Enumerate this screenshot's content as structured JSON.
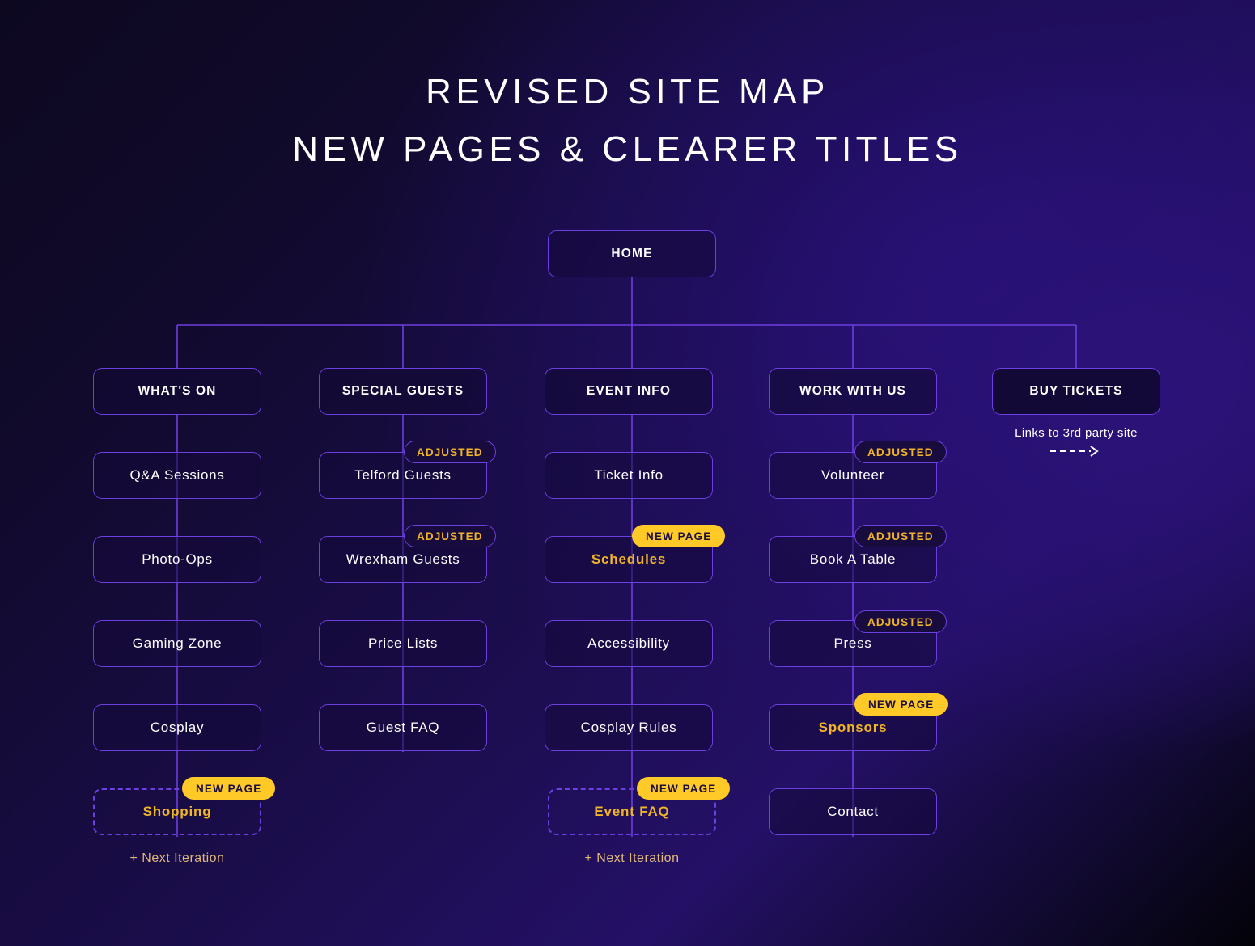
{
  "title": {
    "line1": "REVISED SITE MAP",
    "line2": "NEW PAGES & CLEARER TITLES"
  },
  "theme": {
    "node_border": "#6c3fe0",
    "wire": "#6c3fe0",
    "new_page_badge_bg": "#ffc928",
    "adjusted_badge_text": "#f0b429",
    "gold_text": "#f0b429",
    "annotation_text": "#e0b87a",
    "text": "#ffffff"
  },
  "badges": {
    "new_page": "NEW PAGE",
    "adjusted": "ADJUSTED"
  },
  "annotations": {
    "next_iteration": "+ Next Iteration",
    "external_link": "Links to 3rd party site",
    "external_arrow": "dashed-arrow-right-icon"
  },
  "root": {
    "label": "HOME"
  },
  "columns": [
    {
      "id": "whats-on",
      "top": {
        "label": "WHAT'S ON"
      },
      "children": [
        {
          "label": "Q&A Sessions",
          "badge": null,
          "style": "normal"
        },
        {
          "label": "Photo-Ops",
          "badge": null,
          "style": "normal"
        },
        {
          "label": "Gaming Zone",
          "badge": null,
          "style": "normal"
        },
        {
          "label": "Cosplay",
          "badge": null,
          "style": "normal"
        },
        {
          "label": "Shopping",
          "badge": "new_page",
          "style": "dashed-gold"
        }
      ],
      "footer": "+ Next Iteration"
    },
    {
      "id": "special-guests",
      "top": {
        "label": "SPECIAL GUESTS"
      },
      "children": [
        {
          "label": "Telford Guests",
          "badge": "adjusted",
          "style": "normal"
        },
        {
          "label": "Wrexham Guests",
          "badge": "adjusted",
          "style": "normal"
        },
        {
          "label": "Price Lists",
          "badge": null,
          "style": "normal"
        },
        {
          "label": "Guest FAQ",
          "badge": null,
          "style": "normal"
        }
      ],
      "footer": null
    },
    {
      "id": "event-info",
      "top": {
        "label": "EVENT INFO"
      },
      "children": [
        {
          "label": "Ticket Info",
          "badge": null,
          "style": "normal"
        },
        {
          "label": "Schedules",
          "badge": "new_page",
          "style": "gold"
        },
        {
          "label": "Accessibility",
          "badge": null,
          "style": "normal"
        },
        {
          "label": "Cosplay Rules",
          "badge": null,
          "style": "normal"
        },
        {
          "label": "Event FAQ",
          "badge": "new_page",
          "style": "dashed-gold"
        }
      ],
      "footer": "+ Next Iteration"
    },
    {
      "id": "work-with-us",
      "top": {
        "label": "WORK WITH US"
      },
      "children": [
        {
          "label": "Volunteer",
          "badge": "adjusted",
          "style": "normal"
        },
        {
          "label": "Book A Table",
          "badge": "adjusted",
          "style": "normal"
        },
        {
          "label": "Press",
          "badge": "adjusted",
          "style": "normal"
        },
        {
          "label": "Sponsors",
          "badge": "new_page",
          "style": "gold"
        },
        {
          "label": "Contact",
          "badge": null,
          "style": "normal"
        }
      ],
      "footer": null
    },
    {
      "id": "buy-tickets",
      "top": {
        "label": "BUY TICKETS",
        "external": true
      },
      "children": [],
      "footer": null,
      "note": "Links to 3rd party site"
    }
  ]
}
